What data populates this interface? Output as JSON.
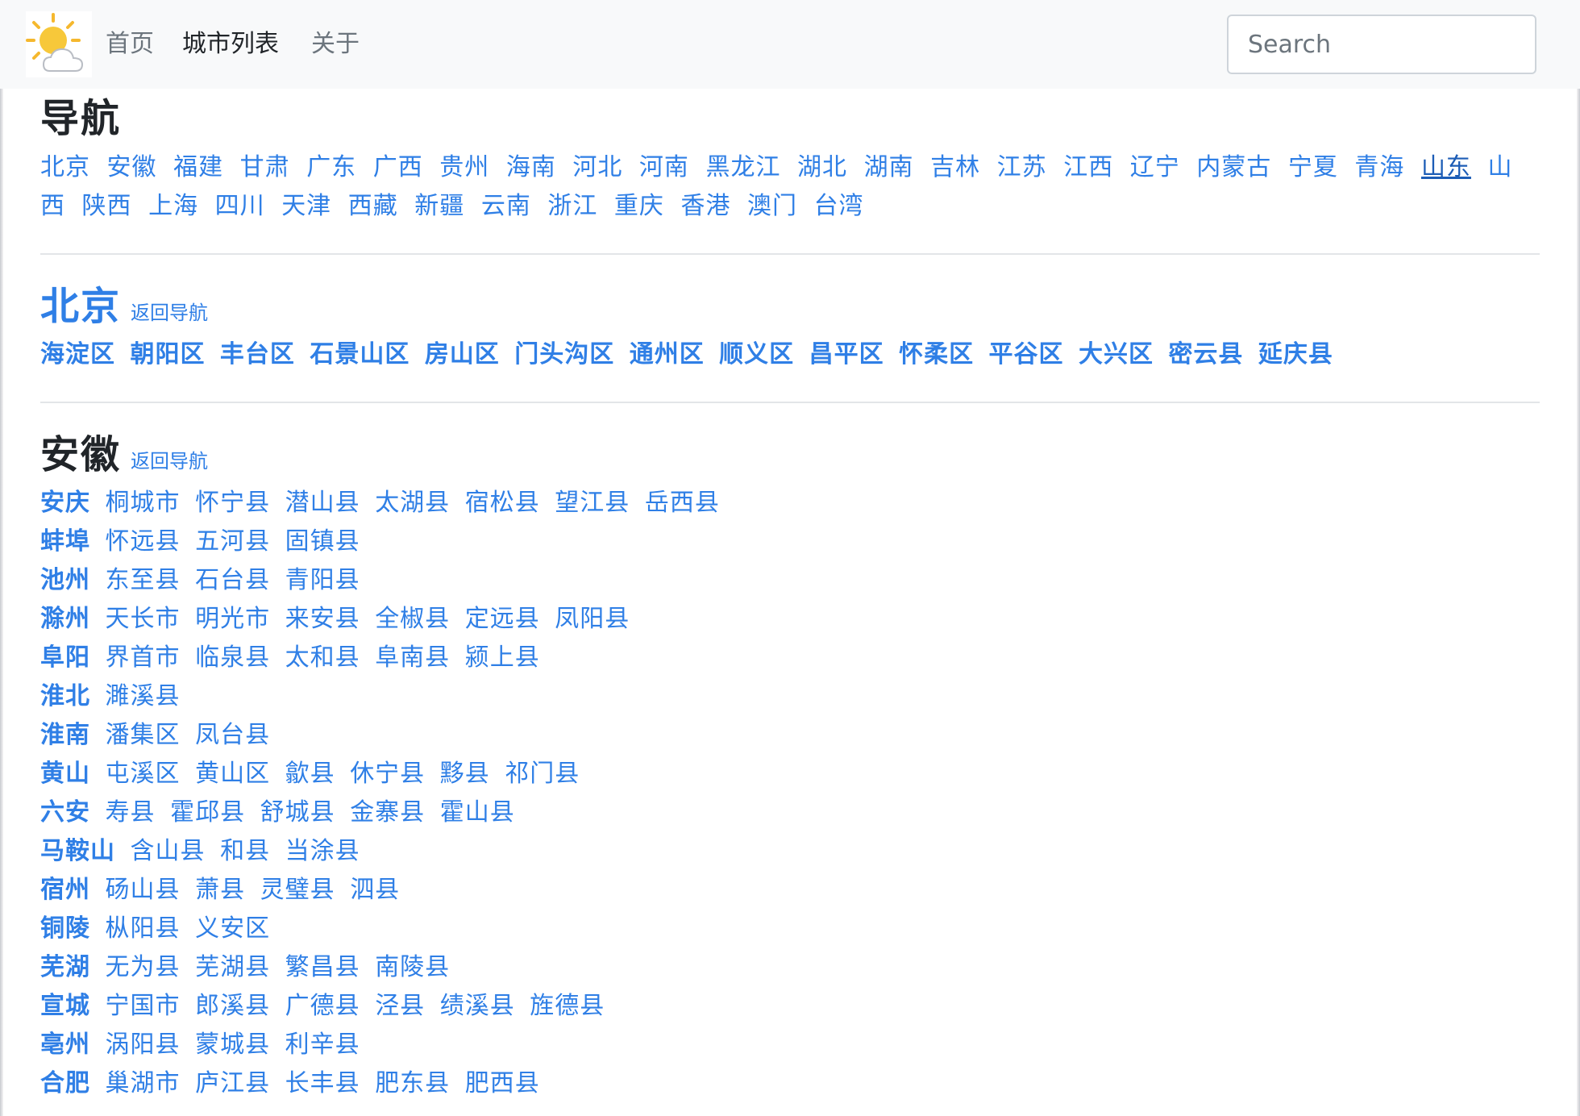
{
  "navbar": {
    "links": [
      {
        "label": "首页"
      },
      {
        "label": "城市列表"
      },
      {
        "label": "关于"
      }
    ],
    "search_placeholder": "Search"
  },
  "nav_section": {
    "title": "导航",
    "provinces": [
      "北京",
      "安徽",
      "福建",
      "甘肃",
      "广东",
      "广西",
      "贵州",
      "海南",
      "河北",
      "河南",
      "黑龙江",
      "湖北",
      "湖南",
      "吉林",
      "江苏",
      "江西",
      "辽宁",
      "内蒙古",
      "宁夏",
      "青海",
      "山东",
      "山西",
      "陕西",
      "上海",
      "四川",
      "天津",
      "西藏",
      "新疆",
      "云南",
      "浙江",
      "重庆",
      "香港",
      "澳门",
      "台湾"
    ],
    "hovered": "山东"
  },
  "beijing": {
    "name": "北京",
    "back_label": "返回导航",
    "districts": [
      "海淀区",
      "朝阳区",
      "丰台区",
      "石景山区",
      "房山区",
      "门头沟区",
      "通州区",
      "顺义区",
      "昌平区",
      "怀柔区",
      "平谷区",
      "大兴区",
      "密云县",
      "延庆县"
    ]
  },
  "anhui": {
    "name": "安徽",
    "back_label": "返回导航",
    "cities": [
      {
        "name": "安庆",
        "counties": [
          "桐城市",
          "怀宁县",
          "潜山县",
          "太湖县",
          "宿松县",
          "望江县",
          "岳西县"
        ]
      },
      {
        "name": "蚌埠",
        "counties": [
          "怀远县",
          "五河县",
          "固镇县"
        ]
      },
      {
        "name": "池州",
        "counties": [
          "东至县",
          "石台县",
          "青阳县"
        ]
      },
      {
        "name": "滁州",
        "counties": [
          "天长市",
          "明光市",
          "来安县",
          "全椒县",
          "定远县",
          "凤阳县"
        ]
      },
      {
        "name": "阜阳",
        "counties": [
          "界首市",
          "临泉县",
          "太和县",
          "阜南县",
          "颍上县"
        ]
      },
      {
        "name": "淮北",
        "counties": [
          "濉溪县"
        ]
      },
      {
        "name": "淮南",
        "counties": [
          "潘集区",
          "凤台县"
        ]
      },
      {
        "name": "黄山",
        "counties": [
          "屯溪区",
          "黄山区",
          "歙县",
          "休宁县",
          "黟县",
          "祁门县"
        ]
      },
      {
        "name": "六安",
        "counties": [
          "寿县",
          "霍邱县",
          "舒城县",
          "金寨县",
          "霍山县"
        ]
      },
      {
        "name": "马鞍山",
        "counties": [
          "含山县",
          "和县",
          "当涂县"
        ]
      },
      {
        "name": "宿州",
        "counties": [
          "砀山县",
          "萧县",
          "灵璧县",
          "泗县"
        ]
      },
      {
        "name": "铜陵",
        "counties": [
          "枞阳县",
          "义安区"
        ]
      },
      {
        "name": "芜湖",
        "counties": [
          "无为县",
          "芜湖县",
          "繁昌县",
          "南陵县"
        ]
      },
      {
        "name": "宣城",
        "counties": [
          "宁国市",
          "郎溪县",
          "广德县",
          "泾县",
          "绩溪县",
          "旌德县"
        ]
      },
      {
        "name": "亳州",
        "counties": [
          "涡阳县",
          "蒙城县",
          "利辛县"
        ]
      },
      {
        "name": "合肥",
        "counties": [
          "巢湖市",
          "庐江县",
          "长丰县",
          "肥东县",
          "肥西县"
        ]
      }
    ]
  },
  "colors": {
    "link": "#2f7fe6",
    "navbar_bg": "#f8f9fa",
    "text": "#212529",
    "muted": "#6c757d"
  }
}
